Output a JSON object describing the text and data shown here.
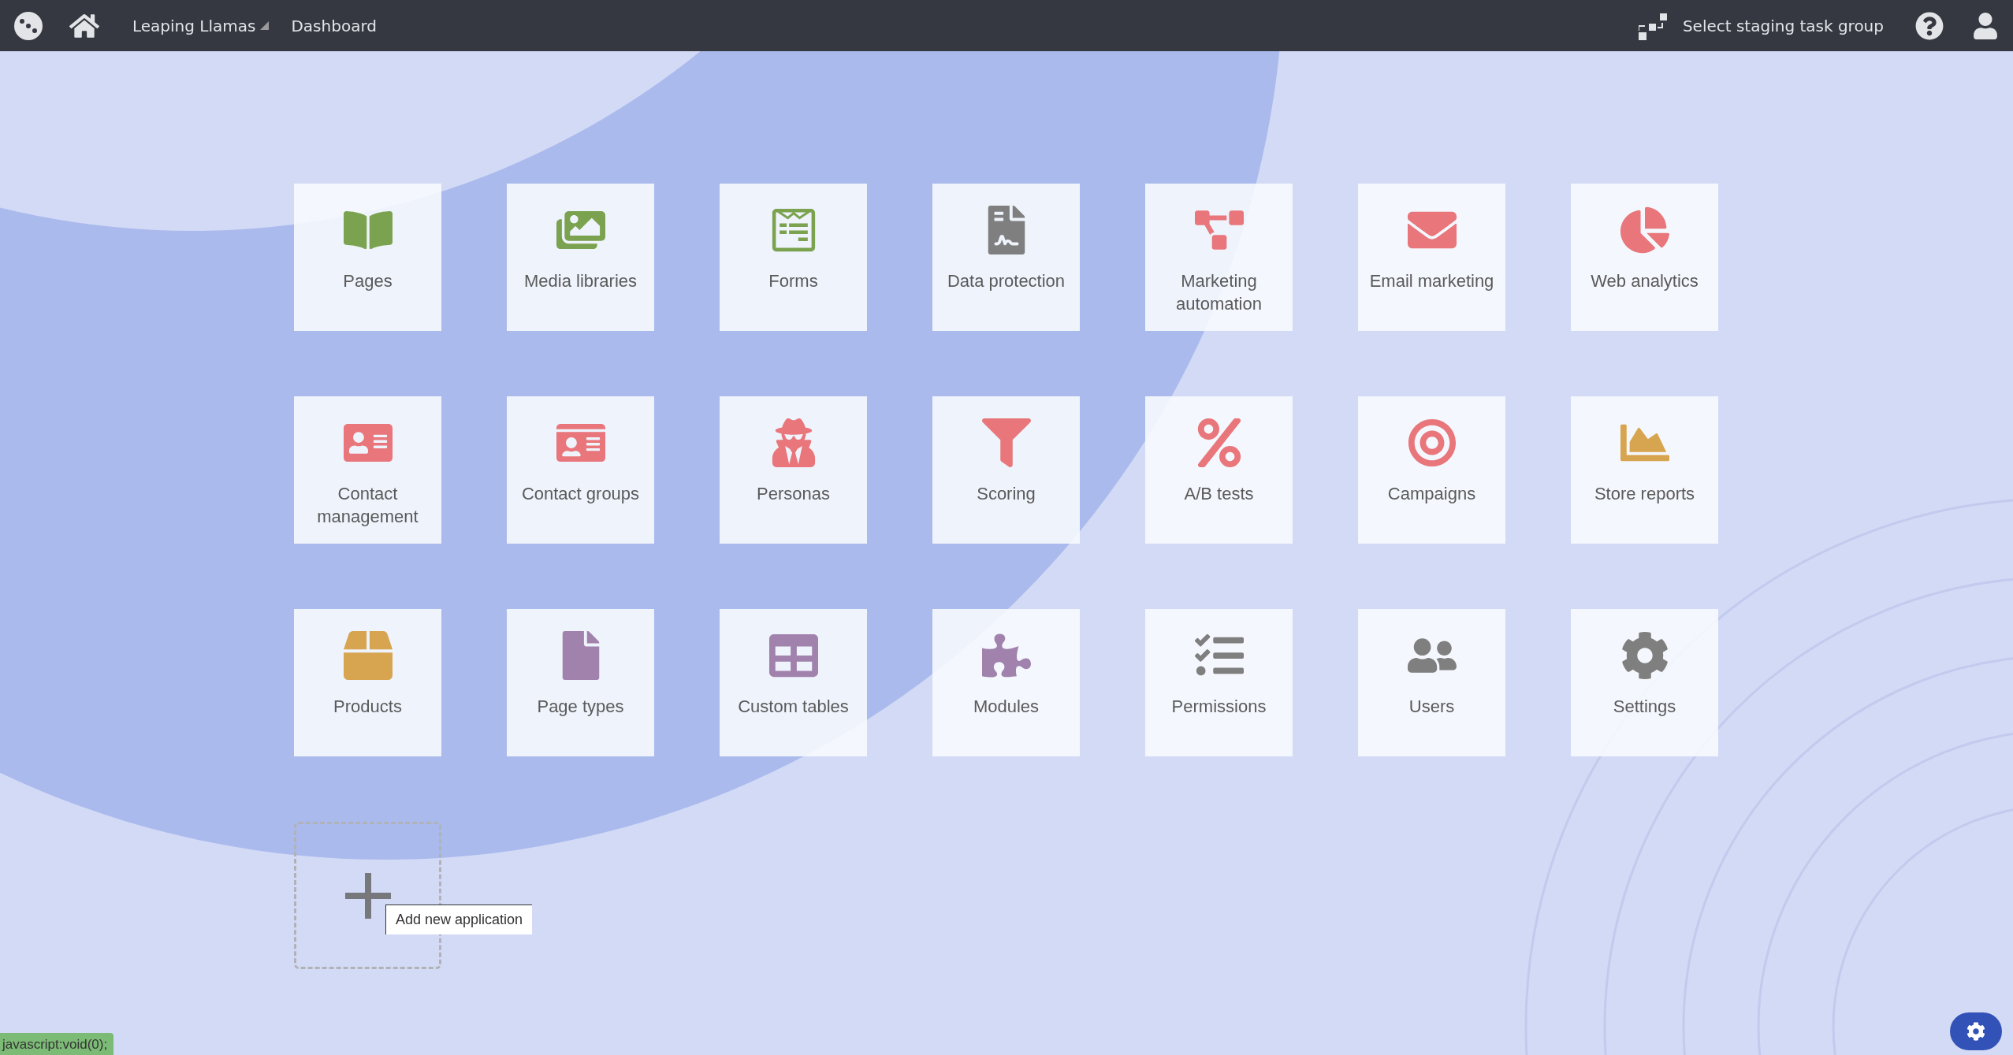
{
  "top_bar": {
    "site": "Leaping Llamas",
    "breadcrumb": "Dashboard",
    "staging": "Select staging task group"
  },
  "applications": [
    {
      "label": "Pages",
      "color": "#7ba34f"
    },
    {
      "label": "Media libraries",
      "color": "#7ba34f"
    },
    {
      "label": "Forms",
      "color": "#7ba34f"
    },
    {
      "label": "Data protection",
      "color": "#7f7f7f"
    },
    {
      "label": "Marketing automation",
      "color": "#e8767a"
    },
    {
      "label": "Email marketing",
      "color": "#e8767a"
    },
    {
      "label": "Web analytics",
      "color": "#e8767a"
    },
    {
      "label": "Contact management",
      "color": "#e8767a"
    },
    {
      "label": "Contact groups",
      "color": "#e8767a"
    },
    {
      "label": "Personas",
      "color": "#e8767a"
    },
    {
      "label": "Scoring",
      "color": "#e8767a"
    },
    {
      "label": "A/B tests",
      "color": "#e8767a"
    },
    {
      "label": "Campaigns",
      "color": "#e8767a"
    },
    {
      "label": "Store reports",
      "color": "#d7a54f"
    },
    {
      "label": "Products",
      "color": "#d7a54f"
    },
    {
      "label": "Page types",
      "color": "#a082ad"
    },
    {
      "label": "Custom tables",
      "color": "#a082ad"
    },
    {
      "label": "Modules",
      "color": "#a082ad"
    },
    {
      "label": "Permissions",
      "color": "#7f7f7f"
    },
    {
      "label": "Users",
      "color": "#7f7f7f"
    },
    {
      "label": "Settings",
      "color": "#7f7f7f"
    }
  ],
  "add_tile": {
    "tooltip": "Add new application"
  },
  "status_bar": "javascript:void(0);"
}
